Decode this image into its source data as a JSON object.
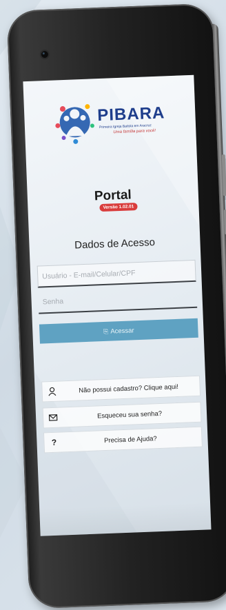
{
  "colors": {
    "brand_blue": "#1f3e8c",
    "version_badge": "#d93c3c",
    "login_button": "#5fa2c2"
  },
  "logo": {
    "name": "PIBARA",
    "subtitle": "Primeira Igreja Batista em Aracruz",
    "tagline": "Uma família para você!"
  },
  "header": {
    "title": "Portal",
    "version": "Versão 1.02.01"
  },
  "form": {
    "section_title": "Dados de Acesso",
    "user_placeholder": "Usuário - E-mail/Celular/CPF",
    "password_placeholder": "Senha",
    "submit_icon": "login-icon",
    "submit_label": "Acessar"
  },
  "links": [
    {
      "icon": "user-icon",
      "label": "Não possui cadastro? Clique aqui!"
    },
    {
      "icon": "envelope-icon",
      "label": "Esqueceu sua senha?"
    },
    {
      "icon": "question-icon",
      "label": "Precisa de Ajuda?"
    }
  ]
}
